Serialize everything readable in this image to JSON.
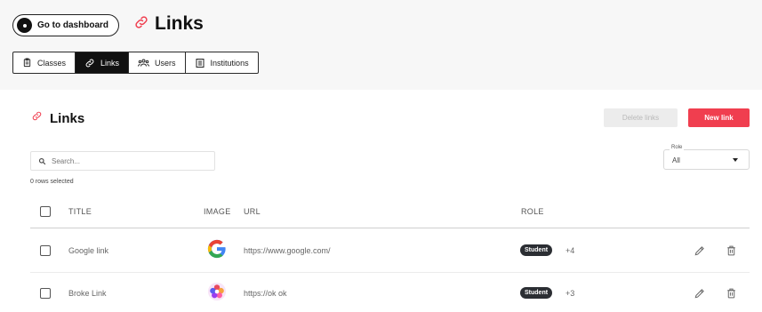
{
  "header": {
    "dashboard_button": "Go to dashboard",
    "page_title": "Links",
    "tabs": [
      {
        "label": "Classes",
        "icon": "clipboard-icon",
        "active": false
      },
      {
        "label": "Links",
        "icon": "link-icon",
        "active": true
      },
      {
        "label": "Users",
        "icon": "users-icon",
        "active": false
      },
      {
        "label": "Institutions",
        "icon": "building-icon",
        "active": false
      }
    ]
  },
  "card": {
    "title": "Links",
    "delete_button": "Delete links",
    "new_button": "New link",
    "search_placeholder": "Search...",
    "role_filter": {
      "label": "Role",
      "value": "All"
    },
    "rows_selected": "0 rows selected",
    "columns": [
      "TITLE",
      "IMAGE",
      "URL",
      "ROLE"
    ],
    "rows": [
      {
        "title": "Google link",
        "image": "google-logo",
        "url": "https://www.google.com/",
        "role": "Student",
        "extra": "+4"
      },
      {
        "title": "Broke Link",
        "image": "flower-logo",
        "url": "https://ok ok",
        "role": "Student",
        "extra": "+3"
      }
    ]
  },
  "colors": {
    "accent": "#f03e4f",
    "dark": "#111111",
    "badge": "#2b2e33"
  }
}
